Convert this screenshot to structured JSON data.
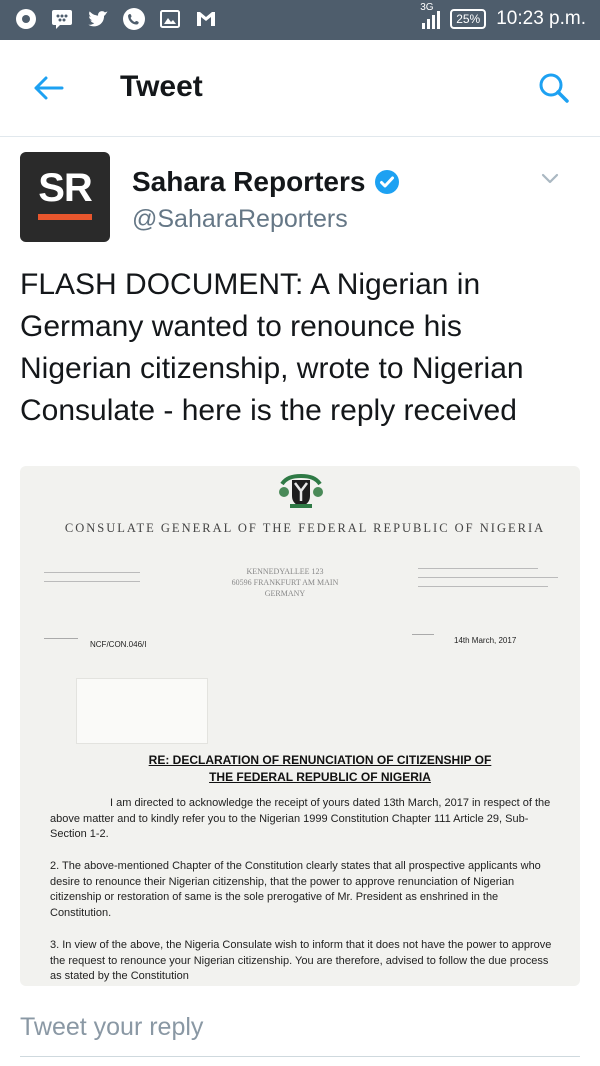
{
  "status_bar": {
    "left_icons": [
      "circle-app-icon",
      "bbm-icon",
      "twitter-bird-icon",
      "phone-icon",
      "image-icon",
      "gmail-icon"
    ],
    "network": "3G",
    "battery": "25%",
    "time": "10:23 p.m."
  },
  "app_bar": {
    "title": "Tweet",
    "back_icon": "arrow-left-icon",
    "search_icon": "search-icon"
  },
  "tweet": {
    "avatar_text": "SR",
    "author_name": "Sahara Reporters",
    "handle": "@SaharaReporters",
    "text": "FLASH DOCUMENT: A Nigerian in Germany wanted to renounce his Nigerian citizenship, wrote to Nigerian Consulate - here is the reply received"
  },
  "document": {
    "heading": "CONSULATE GENERAL OF THE FEDERAL REPUBLIC OF NIGERIA",
    "address": "KENNEDYALLEE 123\n60596 FRANKFURT AM MAIN\nGERMANY",
    "reference": "NCF/CON.046/I",
    "date": "14th March, 2017",
    "subject_line1": "RE: DECLARATION OF RENUNCIATION OF CITIZENSHIP OF",
    "subject_line2": "THE FEDERAL REPUBLIC OF NIGERIA",
    "paragraph1": "I am directed to acknowledge the receipt of yours dated 13th March, 2017 in respect of the above matter and to kindly refer you to the Nigerian 1999 Constitution Chapter 111 Article 29, Sub-Section 1-2.",
    "paragraph2": "2.   The above-mentioned Chapter of the Constitution clearly states that all prospective applicants who desire to renounce their Nigerian citizenship, that the power to approve renunciation of Nigerian citizenship or restoration of same is the sole prerogative of Mr. President as enshrined in the Constitution.",
    "paragraph3": "3.   In view of the above, the Nigeria Consulate wish to inform that it does not have the power to approve the request to renounce your Nigerian citizenship. You are therefore, advised to follow the due process as stated by the Constitution"
  },
  "reply_box": {
    "placeholder": "Tweet your reply"
  },
  "colors": {
    "twitter_blue": "#1da1f2",
    "status_bar": "#4e5d6c",
    "avatar_accent": "#e8562d"
  }
}
